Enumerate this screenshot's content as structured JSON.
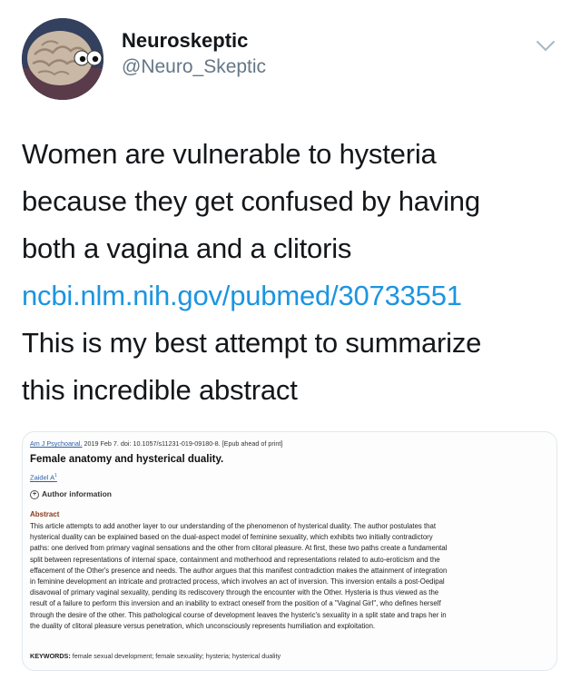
{
  "tweet": {
    "author": {
      "display_name": "Neuroskeptic",
      "handle": "@Neuro_Skeptic",
      "avatar_icon": "brain-with-eyes-icon",
      "menu_icon": "chevron-down-icon"
    },
    "text_lines": [
      "Women are vulnerable to hysteria",
      "because they get confused by having",
      "both a vagina and a clitoris"
    ],
    "link": "ncbi.nlm.nih.gov/pubmed/30733551",
    "text_lines_after": [
      "This is my best attempt to summarize",
      "this incredible abstract"
    ],
    "colors": {
      "link": "#1b95e0",
      "handle": "#657786",
      "text": "#14171a"
    }
  },
  "abstract": {
    "journal": "Am J Psychoanal.",
    "citation_rest": " 2019 Feb 7. doi: 10.1057/s11231-019-09180-8. [Epub ahead of print]",
    "title": "Female anatomy and hysterical duality.",
    "author": "Zaidel A",
    "author_sup": "1",
    "author_info": "Author information",
    "heading": "Abstract",
    "body_lines": [
      "This article attempts to add another layer to our understanding of the phenomenon of hysterical duality. The author postulates that",
      "hysterical duality can be explained based on the dual-aspect model of feminine sexuality, which exhibits two initially contradictory",
      "paths: one derived from primary vaginal sensations and the other from clitoral pleasure. At first, these two paths create a fundamental",
      "split between representations of internal space, containment and motherhood and representations related to auto-eroticism and the",
      "effacement of the Other's presence and needs. The author argues that this manifest contradiction makes the attainment of integration",
      "in feminine development an intricate and protracted process, which involves an act of inversion. This inversion entails a post-Oedipal",
      "disavowal of primary vaginal sexuality, pending its rediscovery through the encounter with the Other. Hysteria is thus viewed as the",
      "result of a failure to perform this inversion and an inability to extract oneself from the position of a \"Vaginal Girl\", who defines herself",
      "through the desire of the other. This pathological course of development leaves the hysteric's sexuality in a split state and traps her in",
      "the duality of clitoral pleasure versus penetration, which unconsciously represents humiliation and exploitation."
    ],
    "keywords_label": "KEYWORDS:",
    "keywords": " female sexual development; female sexuality; hysteria; hysterical duality"
  }
}
